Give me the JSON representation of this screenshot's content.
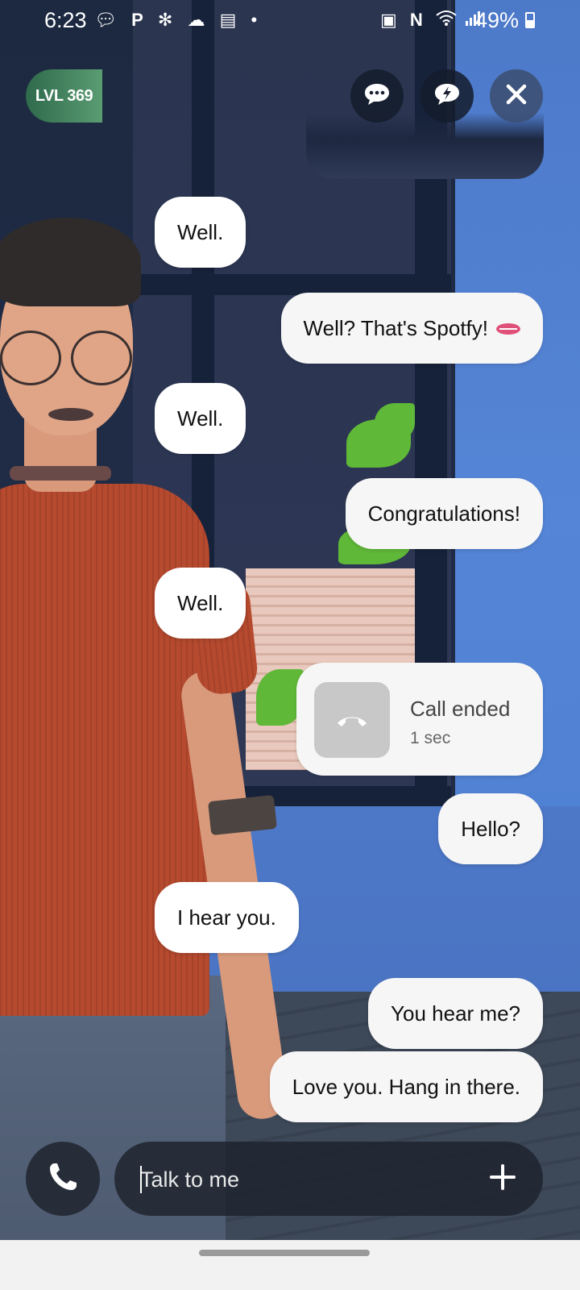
{
  "status_bar": {
    "time": "6:23",
    "left_icons": [
      "chat-bubble-icon",
      "p-icon",
      "fan-icon",
      "cloud-icon",
      "clipboard-icon",
      "dot-icon"
    ],
    "right_icons": [
      "lock-icon",
      "nfc-icon",
      "wifi-icon",
      "signal-icon"
    ],
    "battery": "49%"
  },
  "header": {
    "level_label": "LVL 369",
    "buttons": [
      "chat-options-icon",
      "spark-bubble-icon",
      "close-icon"
    ]
  },
  "messages": [
    {
      "side": "in",
      "text": "Well."
    },
    {
      "side": "out",
      "text": "Well? That's Spotfy!",
      "emoji": "lips-emoji"
    },
    {
      "side": "in",
      "text": "Well."
    },
    {
      "side": "out",
      "text": "Congratulations!"
    },
    {
      "side": "in",
      "text": "Well."
    },
    {
      "side": "out",
      "type": "call",
      "title": "Call ended",
      "duration": "1 sec"
    },
    {
      "side": "out",
      "text": "Hello?"
    },
    {
      "side": "in",
      "text": "I hear you."
    },
    {
      "side": "out",
      "text": "You hear me?"
    },
    {
      "side": "out",
      "text": "Love you. Hang in there."
    }
  ],
  "composer": {
    "placeholder": "Talk to me",
    "value": ""
  },
  "colors": {
    "level_badge": "#4f8c66",
    "bubble": "#ffffff",
    "control_bg": "#1e2433"
  }
}
